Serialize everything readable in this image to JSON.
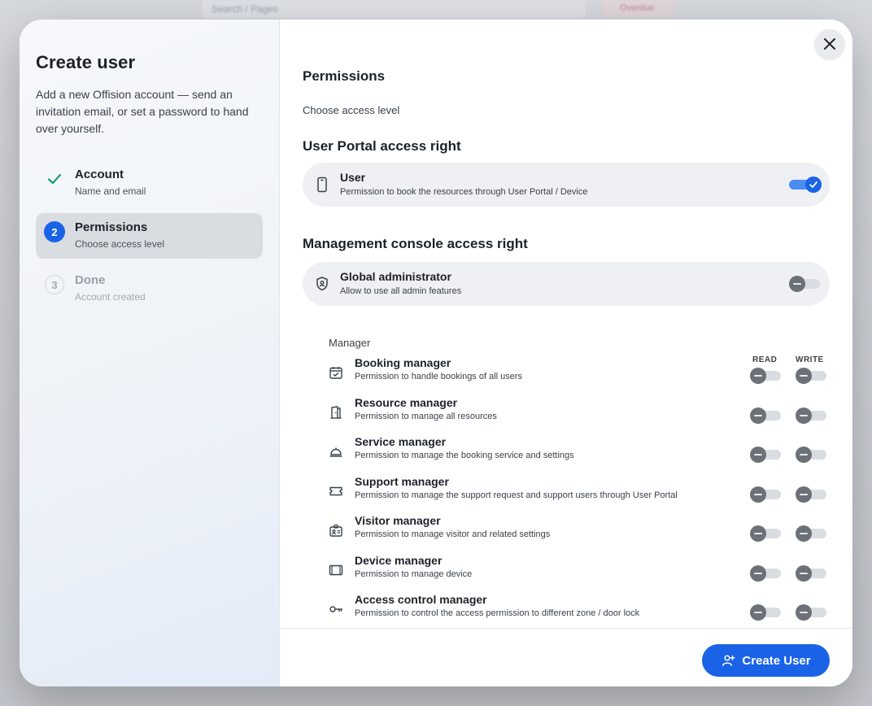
{
  "backdrop": {
    "search_placeholder": "Search / Pages",
    "chip": "Overdue",
    "bottom_text": ""
  },
  "sidebar": {
    "title": "Create user",
    "description": "Add a new Offision account — send an invitation email, or set a password to hand over yourself.",
    "steps": [
      {
        "number": "",
        "title": "Account",
        "subtitle": "Name and email",
        "state": "done"
      },
      {
        "number": "2",
        "title": "Permissions",
        "subtitle": "Choose access level",
        "state": "active"
      },
      {
        "number": "3",
        "title": "Done",
        "subtitle": "Account created",
        "state": "pending"
      }
    ]
  },
  "main": {
    "title": "Permissions",
    "subtitle": "Choose access level",
    "portal": {
      "heading": "User Portal access right",
      "card": {
        "title": "User",
        "subtitle": "Permission to book the resources through User Portal / Device",
        "enabled": true,
        "icon": "phone-icon"
      }
    },
    "console": {
      "heading": "Management console access right",
      "card": {
        "title": "Global administrator",
        "subtitle": "Allow to use all admin features",
        "enabled": false,
        "icon": "shield-icon"
      },
      "manager_label": "Manager",
      "columns": {
        "read": "READ",
        "write": "WRITE"
      },
      "managers": [
        {
          "title": "Booking manager",
          "subtitle": "Permission to handle bookings of all users",
          "icon": "calendar-check-icon",
          "read": false,
          "write": false
        },
        {
          "title": "Resource manager",
          "subtitle": "Permission to manage all resources",
          "icon": "door-icon",
          "read": false,
          "write": false
        },
        {
          "title": "Service manager",
          "subtitle": "Permission to manage the booking service and settings",
          "icon": "service-bell-icon",
          "read": false,
          "write": false
        },
        {
          "title": "Support manager",
          "subtitle": "Permission to manage the support request and support users through User Portal",
          "icon": "ticket-icon",
          "read": false,
          "write": false
        },
        {
          "title": "Visitor manager",
          "subtitle": "Permission to manage visitor and related settings",
          "icon": "visitor-badge-icon",
          "read": false,
          "write": false
        },
        {
          "title": "Device manager",
          "subtitle": "Permission to manage device",
          "icon": "tablet-device-icon",
          "read": false,
          "write": false
        },
        {
          "title": "Access control manager",
          "subtitle": "Permission to control the access permission to different zone / door lock",
          "icon": "key-icon",
          "read": false,
          "write": false
        }
      ]
    }
  },
  "footer": {
    "create_label": "Create User"
  },
  "colors": {
    "accent": "#1a63e6",
    "check": "#16a36a"
  }
}
